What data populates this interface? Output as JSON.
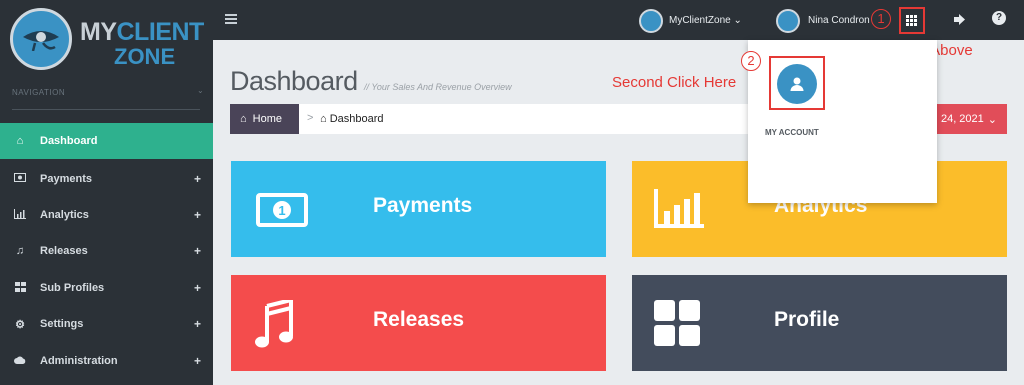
{
  "brand": {
    "part1": "MY",
    "part2": "CLIENT",
    "part3": "ZONE"
  },
  "sidebar": {
    "nav_label": "NAVIGATION",
    "items": [
      {
        "label": "Dashboard",
        "icon": "home-icon",
        "active": true
      },
      {
        "label": "Payments",
        "icon": "money-icon",
        "expandable": true
      },
      {
        "label": "Analytics",
        "icon": "bar-chart-icon",
        "expandable": true
      },
      {
        "label": "Releases",
        "icon": "music-icon",
        "expandable": true
      },
      {
        "label": "Sub Profiles",
        "icon": "grid-icon",
        "expandable": true
      },
      {
        "label": "Settings",
        "icon": "gear-icon",
        "expandable": true
      },
      {
        "label": "Administration",
        "icon": "cloud-icon",
        "expandable": true
      }
    ],
    "plus_symbol": "+"
  },
  "topbar": {
    "zone_menu": "MyClientZone",
    "user_name": "Nina Condron"
  },
  "annotations": {
    "step1_number": "1",
    "step1_text": "First Click Above",
    "step2_number": "2",
    "step2_text": "Second Click Here"
  },
  "page": {
    "title": "Dashboard",
    "subtitle": "// Your Sales And Revenue Overview",
    "breadcrumb_home": "Home",
    "breadcrumb_sep": ">",
    "breadcrumb_current": "Dashboard",
    "date_label": "24, 2021"
  },
  "tiles": [
    {
      "label": "Payments",
      "color": "#35bdec",
      "icon": "money-icon"
    },
    {
      "label": "Analytics",
      "color": "#fbbd2a",
      "icon": "bar-chart-icon"
    },
    {
      "label": "Releases",
      "color": "#f44c4c",
      "icon": "music-icon"
    },
    {
      "label": "Profile",
      "color": "#434c5c",
      "icon": "grid-icon"
    }
  ],
  "dropdown": {
    "my_account_label": "MY ACCOUNT"
  },
  "colors": {
    "sidebar_bg": "#2b3137",
    "active_green": "#2eb18e",
    "brand_blue": "#3a92c4",
    "annotation_red": "#e53935",
    "date_red": "#e14d59"
  }
}
